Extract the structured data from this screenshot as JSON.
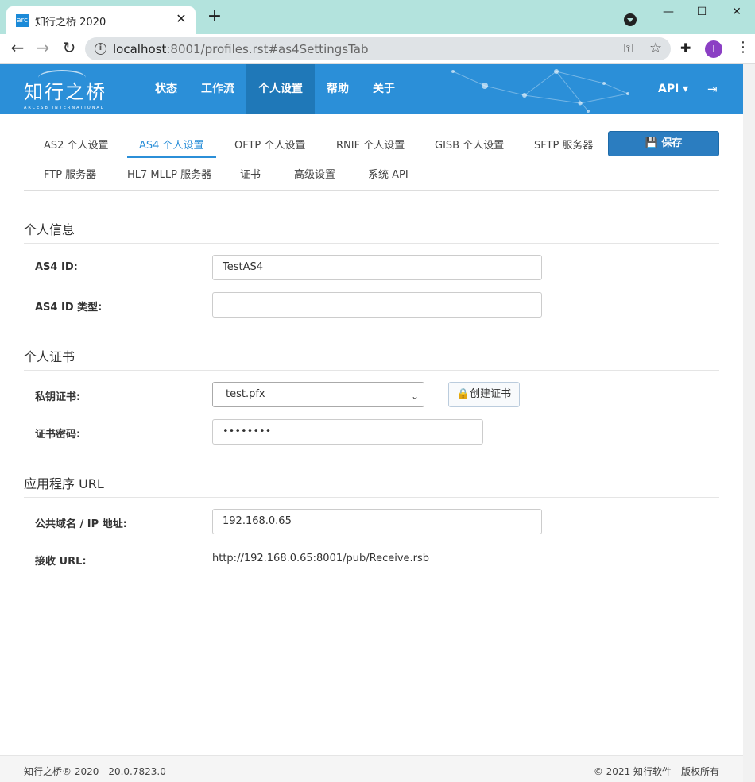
{
  "browser": {
    "tab_title": "知行之桥 2020",
    "favicon_text": "arc",
    "tab_close": "✕",
    "new_tab": "+",
    "url_host": "localhost",
    "url_path": ":8001/profiles.rst#as4SettingsTab",
    "avatar_letter": "I",
    "back": "←",
    "forward": "→",
    "reload": "↻",
    "minimize": "—",
    "maximize": "☐",
    "close": "✕"
  },
  "header": {
    "logo_text": "知行之桥",
    "logo_subtext": "ARCESB INTERNATIONAL",
    "nav": [
      "状态",
      "工作流",
      "个人设置",
      "帮助",
      "关于"
    ],
    "api_menu": "API ▾",
    "brand_color": "#2b8fd8"
  },
  "settings_tabs": {
    "row1": [
      "AS2 个人设置",
      "AS4 个人设置",
      "OFTP 个人设置",
      "RNIF 个人设置",
      "GISB 个人设置",
      "SFTP 服务器"
    ],
    "row2": [
      "FTP 服务器",
      "HL7 MLLP 服务器",
      "证书",
      "高级设置",
      "系统 API"
    ],
    "active": "AS4 个人设置",
    "save_label": "保存"
  },
  "sections": {
    "personal_info": {
      "title": "个人信息",
      "as4_id_label": "AS4 ID:",
      "as4_id_value": "TestAS4",
      "as4_id_type_label": "AS4 ID 类型:",
      "as4_id_type_value": ""
    },
    "personal_cert": {
      "title": "个人证书",
      "private_key_label": "私钥证书:",
      "private_key_value": "test.pfx",
      "create_cert_label": "创建证书",
      "cert_password_label": "证书密码:",
      "cert_password_value": "••••••••"
    },
    "app_url": {
      "title": "应用程序 URL",
      "public_domain_label": "公共域名 / IP 地址:",
      "public_domain_value": "192.168.0.65",
      "receive_url_label": "接收 URL:",
      "receive_url_value": "http://192.168.0.65:8001/pub/Receive.rsb"
    }
  },
  "footer": {
    "left": "知行之桥® 2020 - 20.0.7823.0",
    "right": "© 2021 知行软件 - 版权所有"
  }
}
